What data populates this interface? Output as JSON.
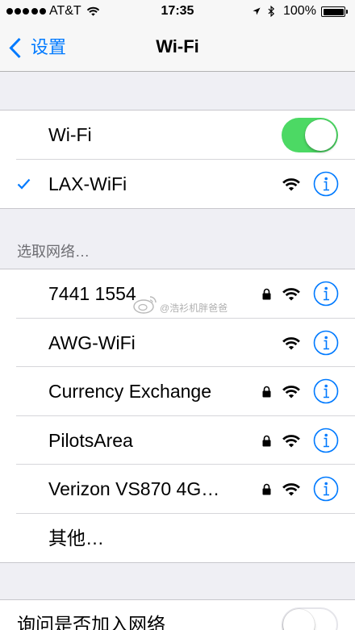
{
  "status_bar": {
    "signal_strength": 5,
    "signal_max": 5,
    "carrier": "AT&T",
    "time": "17:35",
    "battery_percent": "100%",
    "battery_level": 1.0
  },
  "nav": {
    "back_label": "设置",
    "title": "Wi-Fi"
  },
  "wifi_section": {
    "toggle_label": "Wi-Fi",
    "toggle_on": true,
    "connected_network": "LAX-WiFi"
  },
  "networks_header": "选取网络…",
  "networks": [
    {
      "name": "7441 1554",
      "locked": true
    },
    {
      "name": "AWG-WiFi",
      "locked": false
    },
    {
      "name": "Currency Exchange",
      "locked": true
    },
    {
      "name": "PilotsArea",
      "locked": true
    },
    {
      "name": "Verizon VS870 4G…",
      "locked": true
    }
  ],
  "other_label": "其他…",
  "ask_to_join": {
    "label": "询问是否加入网络",
    "toggle_on": false
  },
  "watermark": "@浩衫机胖爸爸",
  "icons": {
    "back": "chevron-left-icon",
    "connected": "checkmark-icon",
    "secured": "lock-icon",
    "signal": "wifi-icon",
    "details": "info-icon"
  },
  "colors": {
    "accent": "#007aff",
    "toggle_on": "#4cd964",
    "background": "#efeff4",
    "section_header": "#6d6d72"
  }
}
